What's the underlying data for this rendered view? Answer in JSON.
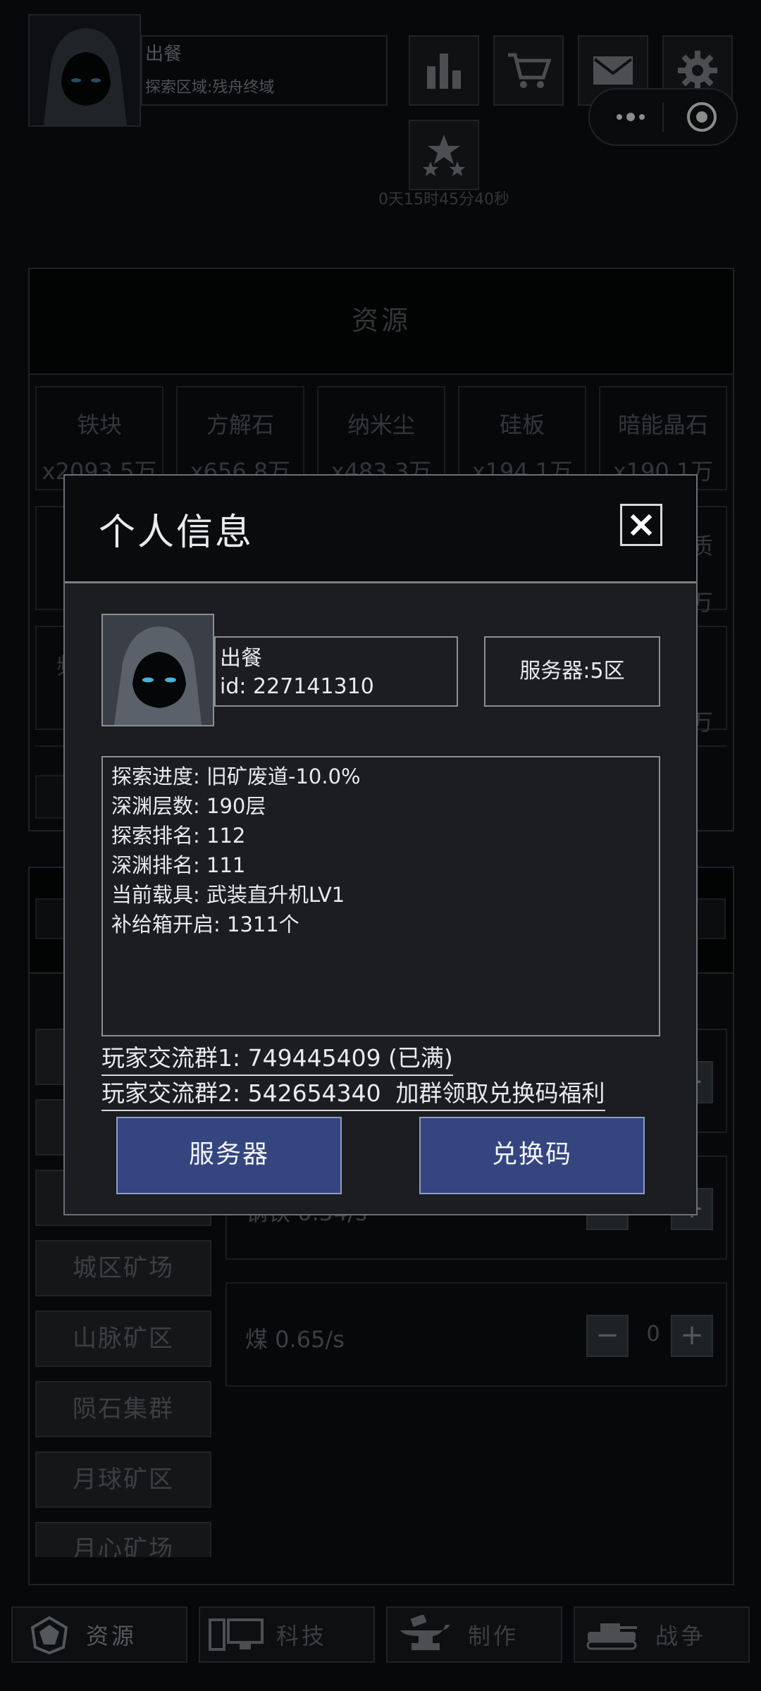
{
  "player": {
    "name": "出餐",
    "area": "探索区域:残舟终域"
  },
  "header": {
    "countdown": "0天15时45分40秒"
  },
  "icons": {
    "stats": "bar-chart-icon",
    "shop": "cart-icon",
    "mail": "mail-icon",
    "settings": "gear-icon",
    "rank": "stars-icon",
    "more": "more-dots-icon",
    "close_app": "target-icon"
  },
  "resources": {
    "title": "资源",
    "items": [
      {
        "name": "铁块",
        "amount": "x2093.5万"
      },
      {
        "name": "方解石",
        "amount": "x656.8万"
      },
      {
        "name": "纳米尘",
        "amount": "x483.3万"
      },
      {
        "name": "硅板",
        "amount": "x194.1万"
      },
      {
        "name": "暗能晶石",
        "amount": "x190.1万"
      }
    ],
    "partial_right_1": "质",
    "partial_right_2": "万",
    "partial_right_3": "万",
    "partial_left": "频"
  },
  "mines": {
    "areas": [
      "城区矿场",
      "山脉矿区",
      "陨石集群",
      "月球矿区",
      "月心矿场"
    ],
    "rates": [
      {
        "label": "煤 0.65/s",
        "count": "0"
      }
    ],
    "partial_rate": "钢铁 0.54/s"
  },
  "bottom_nav": [
    {
      "label": "资源",
      "icon": "gem-icon"
    },
    {
      "label": "科技",
      "icon": "computer-icon"
    },
    {
      "label": "制作",
      "icon": "anvil-icon"
    },
    {
      "label": "战争",
      "icon": "tank-icon"
    }
  ],
  "modal": {
    "title": "个人信息",
    "name": "出餐",
    "id_text": "id: 227141310",
    "server": "服务器:5区",
    "stats": [
      "探索进度: 旧矿废道-10.0%",
      "深渊层数: 190层",
      "探索排名: 112",
      "深渊排名: 111",
      "当前载具: 武装直升机LV1",
      "补给箱开启: 1311个"
    ],
    "group1": "玩家交流群1: 749445409 (已满)",
    "group2": "玩家交流群2: 542654340  加群领取兑换码福利",
    "btn_server": "服务器",
    "btn_code": "兑换码"
  },
  "colors": {
    "accent_button": "#34457f",
    "background": "#0e1013"
  }
}
